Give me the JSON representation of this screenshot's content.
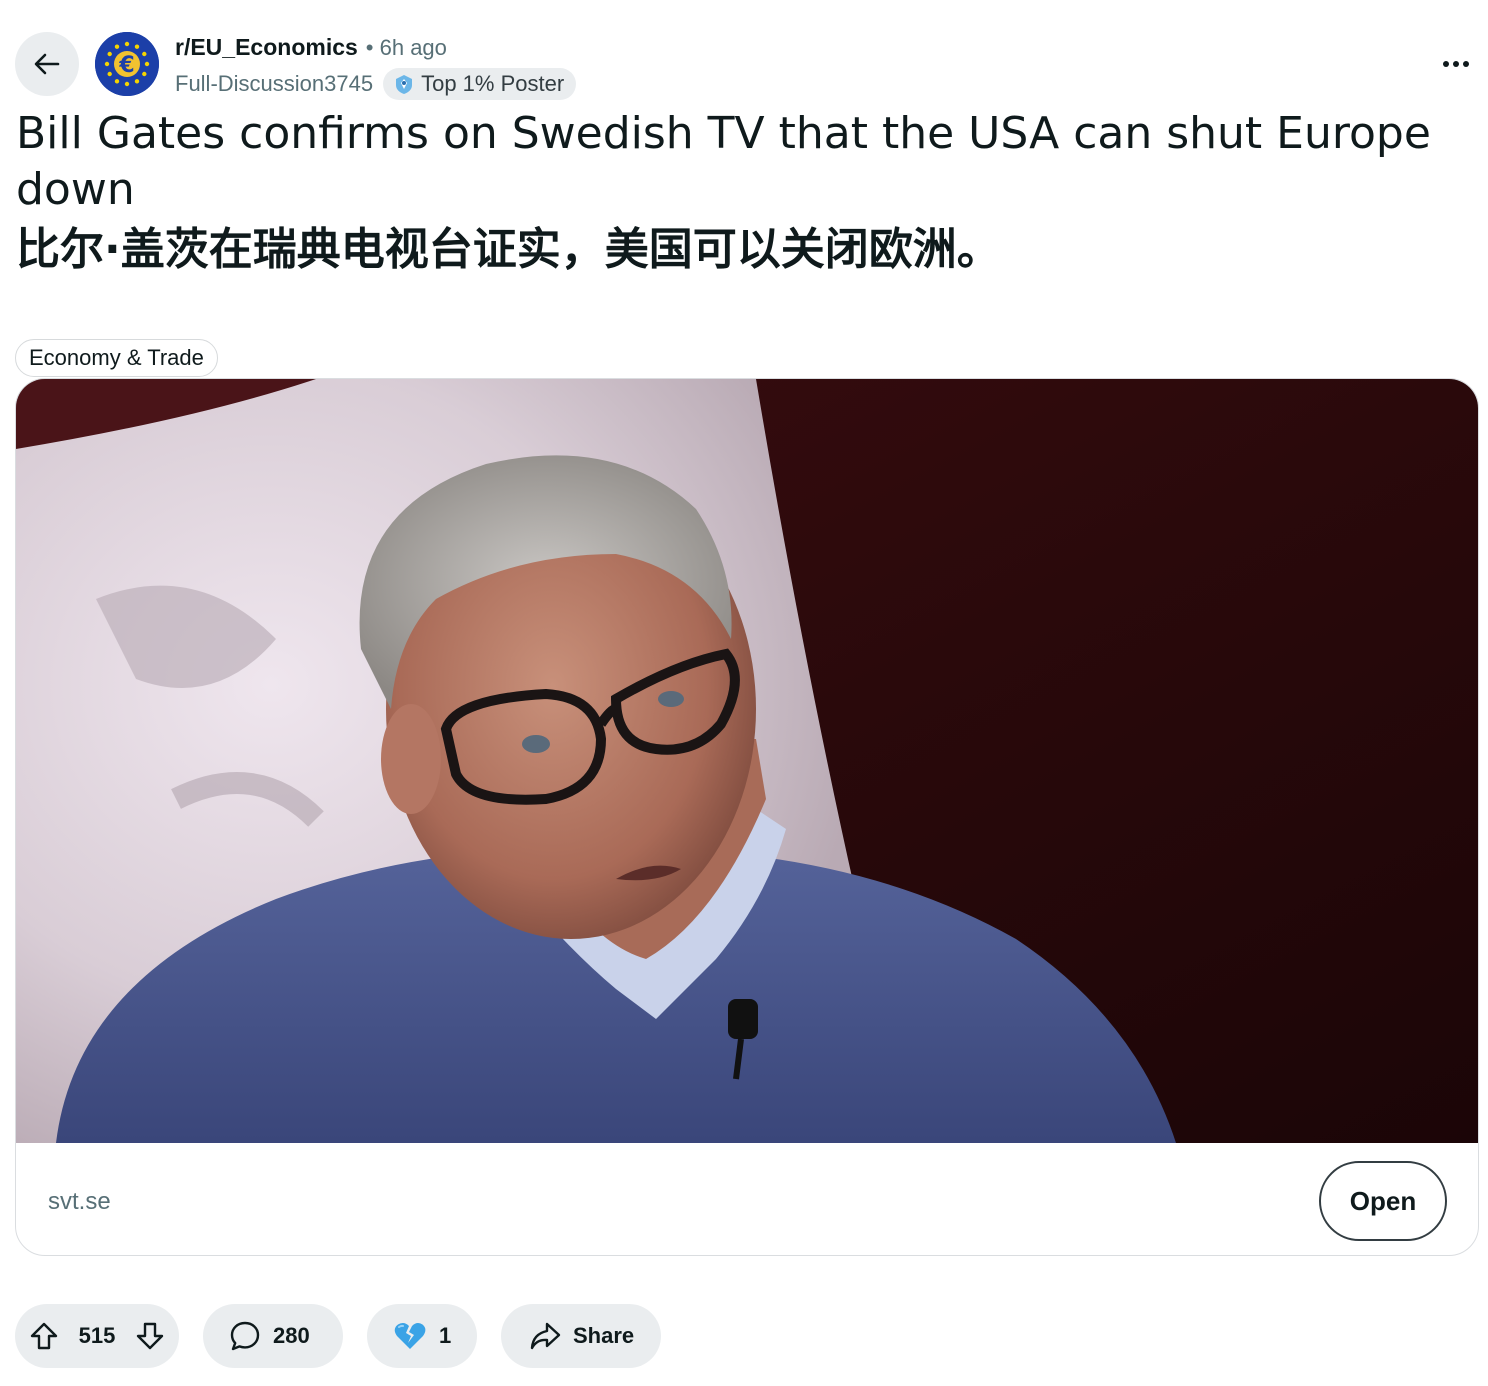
{
  "post": {
    "subreddit": "r/EU_Economics",
    "time_ago": "• 6h ago",
    "author": "Full-Discussion3745",
    "author_badge": "Top 1% Poster",
    "title_en": "Bill Gates confirms on Swedish TV that the USA can shut Europe down",
    "title_cn": "比尔·盖茨在瑞典电视台证实，美国可以关闭欧洲。",
    "flair": "Economy & Trade"
  },
  "link_card": {
    "domain": "svt.se",
    "open_label": "Open"
  },
  "actions": {
    "upvotes": "515",
    "comments": "280",
    "awards": "1",
    "share_label": "Share"
  },
  "colors": {
    "accent": "#1c3fa8",
    "pill_bg": "#eaedef",
    "text_muted": "#576f76"
  },
  "icons": [
    "back-arrow-icon",
    "eu-euro-icon",
    "top-poster-badge-icon",
    "overflow-menu-icon",
    "upvote-icon",
    "downvote-icon",
    "comment-icon",
    "broken-heart-award-icon",
    "share-icon"
  ]
}
